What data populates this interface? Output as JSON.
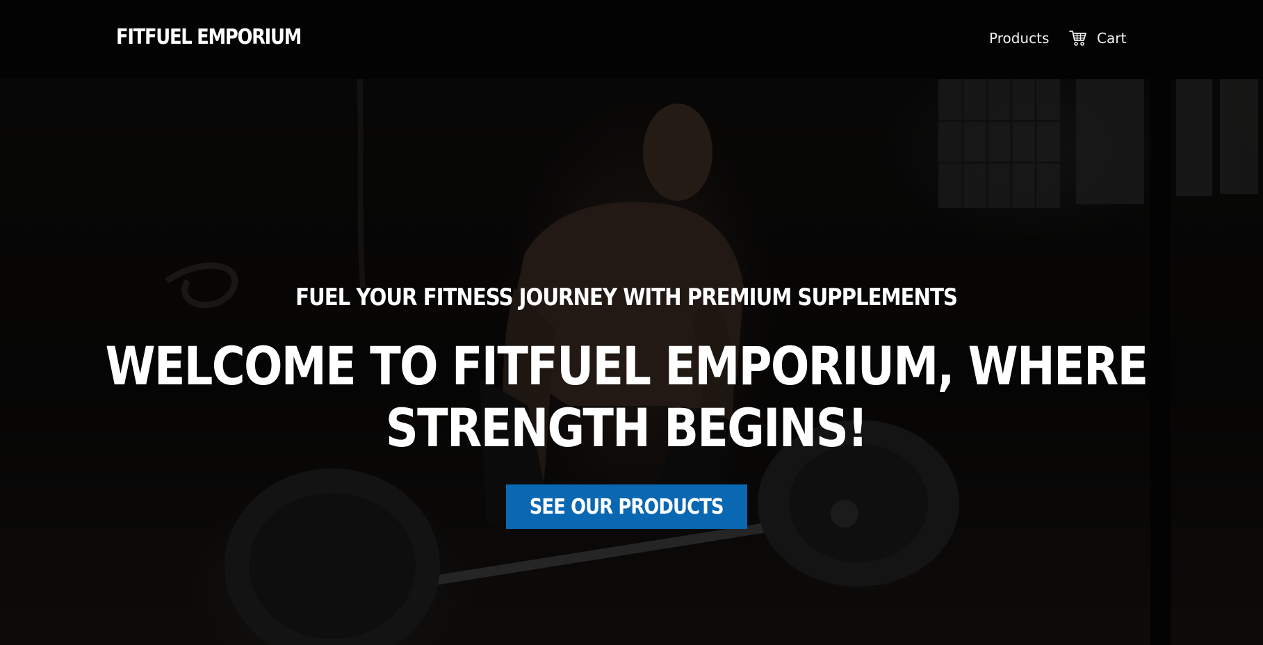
{
  "header": {
    "logo": "FITFUEL EMPORIUM",
    "nav": {
      "products_label": "Products",
      "cart_label": "Cart",
      "cart_icon": "shopping-cart-icon"
    }
  },
  "hero": {
    "subtitle": "FUEL YOUR FITNESS JOURNEY WITH PREMIUM SUPPLEMENTS",
    "headline_line1": "WELCOME TO FITFUEL EMPORIUM, WHERE",
    "headline_line2": "STRENGTH BEGINS!",
    "cta_label": "SEE OUR PRODUCTS",
    "background_image": "man deadlifting a barbell in a dark gym"
  },
  "colors": {
    "header_background": "#030303",
    "button": "#0a67b1",
    "text": "#ffffff"
  }
}
